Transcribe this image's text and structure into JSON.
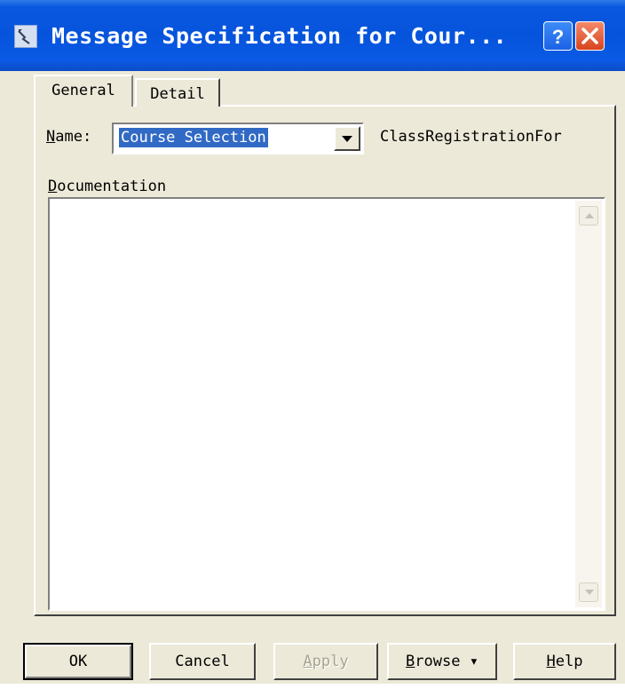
{
  "window": {
    "title": "Message Specification for Cour...",
    "help_button": "?",
    "close_button": "X"
  },
  "tabs": [
    {
      "label": "General"
    },
    {
      "label": "Detail"
    }
  ],
  "form": {
    "name_label_underline": "N",
    "name_label_rest": "ame:",
    "name_value": "Course Selection",
    "class_text": "ClassRegistrationFor",
    "documentation_label_underline": "D",
    "documentation_label_rest": "ocumentation",
    "documentation_value": ""
  },
  "buttons": {
    "ok": "OK",
    "cancel": "Cancel",
    "apply_underline": "A",
    "apply_rest": "pply",
    "browse_underline": "B",
    "browse_rest": "rowse ▾",
    "help_underline": "H",
    "help_rest": "elp"
  }
}
